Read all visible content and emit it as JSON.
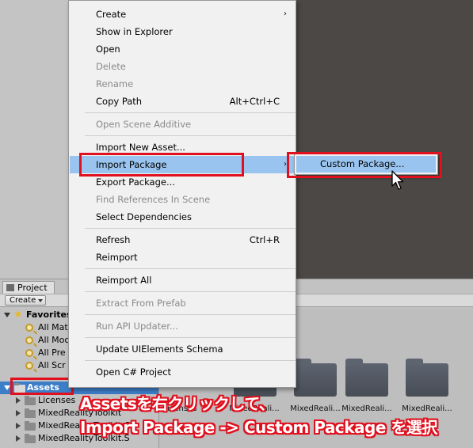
{
  "context_menu": {
    "items": [
      {
        "label": "Create",
        "submenu": true
      },
      {
        "label": "Show in Explorer"
      },
      {
        "label": "Open"
      },
      {
        "label": "Delete",
        "disabled": true
      },
      {
        "label": "Rename",
        "disabled": true
      },
      {
        "label": "Copy Path",
        "shortcut": "Alt+Ctrl+C"
      },
      {
        "label": "Open Scene Additive",
        "disabled": true
      },
      {
        "label": "Import New Asset..."
      },
      {
        "label": "Import Package",
        "submenu": true,
        "highlighted": true
      },
      {
        "label": "Export Package..."
      },
      {
        "label": "Find References In Scene",
        "disabled": true
      },
      {
        "label": "Select Dependencies"
      },
      {
        "label": "Refresh",
        "shortcut": "Ctrl+R"
      },
      {
        "label": "Reimport"
      },
      {
        "label": "Reimport All"
      },
      {
        "label": "Extract From Prefab",
        "disabled": true
      },
      {
        "label": "Run API Updater...",
        "disabled": true
      },
      {
        "label": "Update UIElements Schema"
      },
      {
        "label": "Open C# Project"
      }
    ],
    "submenu_arrow": "›"
  },
  "submenu": {
    "item": "Custom Package..."
  },
  "project": {
    "tab_label": "Project",
    "create_label": "Create",
    "favorites": {
      "label": "Favorites",
      "items": [
        "All Mat",
        "All Moc",
        "All Pre",
        "All Scr"
      ]
    },
    "assets_label": "Assets",
    "tree_children": [
      "Licenses",
      "MixedRealityToolkit",
      "MixedRealityToolkit.Ge",
      "MixedRealityToolkit.S"
    ],
    "grid_labels": [
      "Licenses",
      "MixedReali...",
      "MixedReali...",
      "MixedReali...",
      "MixedReali..."
    ]
  },
  "annotation": {
    "line1": "Assetsを右クリックして、",
    "line2": "Import Package -> Custom Package を選択"
  },
  "colors": {
    "highlight_red": "#e0101e",
    "selection_blue": "#99c4ef",
    "assets_selection": "#3d7ec9"
  }
}
